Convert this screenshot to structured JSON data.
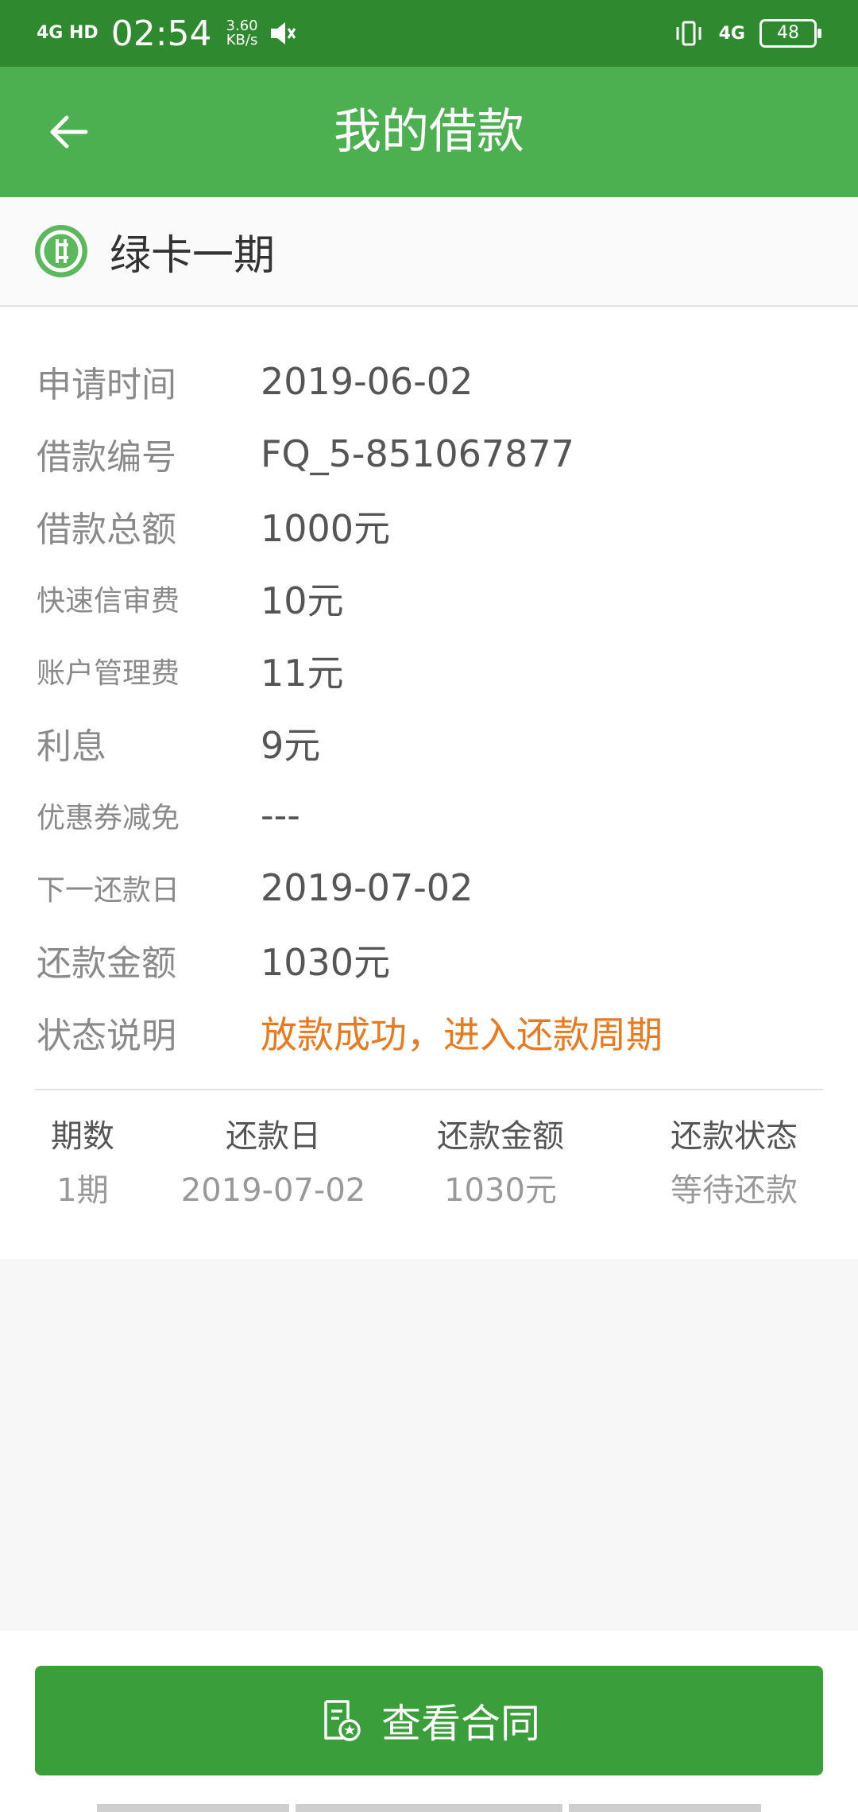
{
  "status_bar": {
    "network": "4G HD",
    "time": "02:54",
    "speed_value": "3.60",
    "speed_unit": "KB/s",
    "right_network": "4G",
    "battery": "48"
  },
  "header": {
    "title": "我的借款"
  },
  "product": {
    "name": "绿卡一期"
  },
  "details": [
    {
      "label": "申请时间",
      "value": "2019-06-02"
    },
    {
      "label": "借款编号",
      "value": "FQ_5-851067877"
    },
    {
      "label": "借款总额",
      "value": "1000元"
    },
    {
      "label": "快速信审费",
      "value": "10元"
    },
    {
      "label": "账户管理费",
      "value": "11元"
    },
    {
      "label": "利息",
      "value": "9元"
    },
    {
      "label": "优惠券减免",
      "value": "---"
    },
    {
      "label": "下一还款日",
      "value": "2019-07-02"
    },
    {
      "label": "还款金额",
      "value": "1030元"
    },
    {
      "label": "状态说明",
      "value": "放款成功，进入还款周期"
    }
  ],
  "schedule": {
    "headers": [
      "期数",
      "还款日",
      "还款金额",
      "还款状态"
    ],
    "rows": [
      [
        "1期",
        "2019-07-02",
        "1030元",
        "等待还款"
      ]
    ]
  },
  "actions": {
    "view_contract": "查看合同"
  },
  "colors": {
    "status_bar": "#2f8a2f",
    "app_bar": "#4caf50",
    "button": "#3a9e3a",
    "status_text": "#e8791e"
  }
}
